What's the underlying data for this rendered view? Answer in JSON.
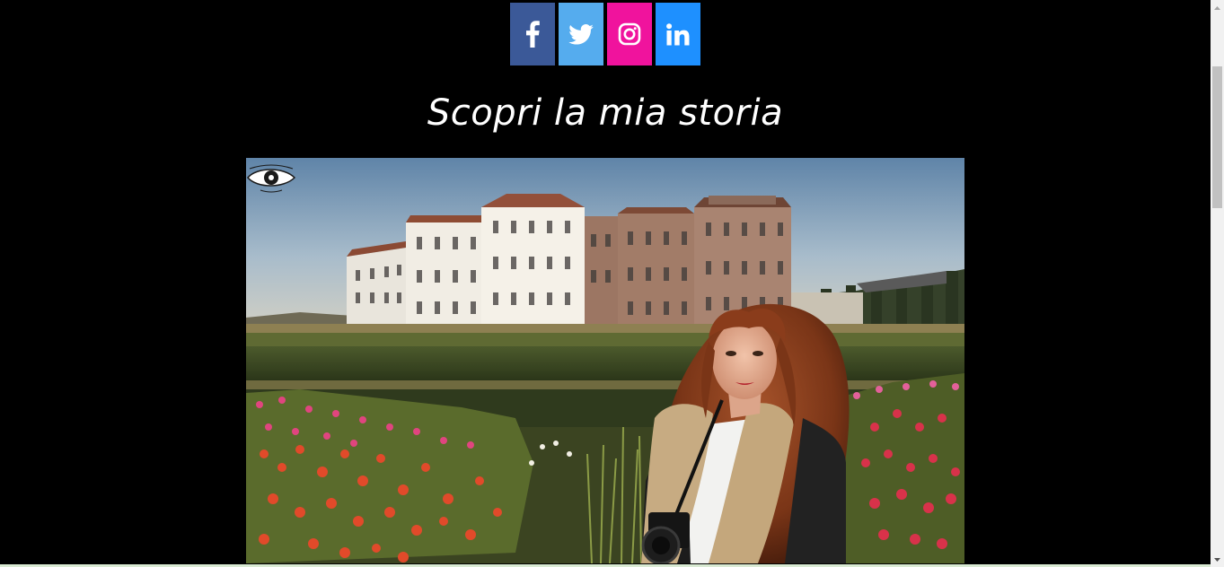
{
  "social": {
    "facebook": {
      "icon": "facebook-icon",
      "color": "#3b5998"
    },
    "twitter": {
      "icon": "twitter-icon",
      "color": "#55acee"
    },
    "instagram": {
      "icon": "instagram-icon",
      "color": "#f0139d"
    },
    "linkedin": {
      "icon": "linkedin-icon",
      "color": "#1e90ff"
    }
  },
  "section": {
    "title": "Scopri la mia storia"
  },
  "photo": {
    "watermark_icon": "eye-logo-icon"
  },
  "colors": {
    "background": "#000000",
    "title_text": "#ffffff"
  }
}
